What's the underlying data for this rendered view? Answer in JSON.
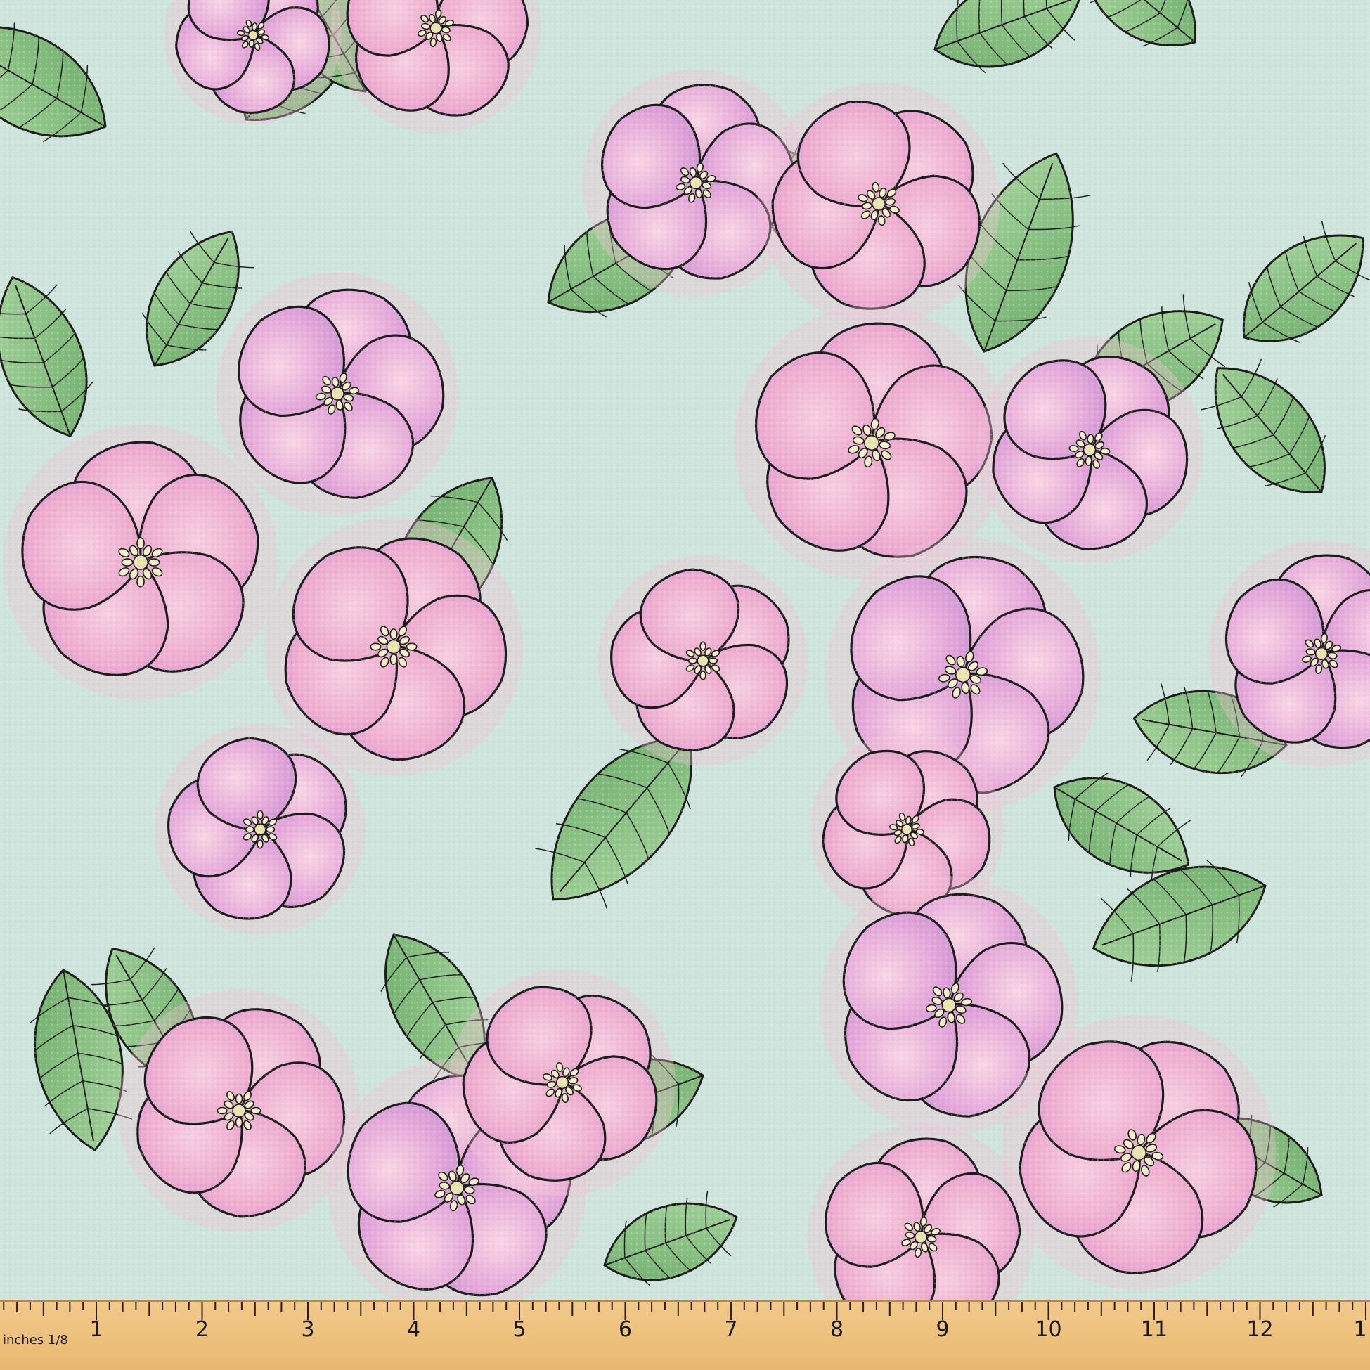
{
  "colors": {
    "background": "#cfe4dc",
    "petal_pink": "#f4b8d4",
    "petal_lilac": "#dca3dc",
    "leaf_green": "#8fc48a",
    "outline": "#1c1c1c",
    "stamen": "#f3efc8",
    "ruler_wood": "#efc27e"
  },
  "ruler": {
    "unit_label": "inches 1/8",
    "numbers": [
      "1",
      "2",
      "3",
      "4",
      "5",
      "6",
      "7",
      "8",
      "9",
      "10",
      "11",
      "12",
      "1"
    ]
  }
}
